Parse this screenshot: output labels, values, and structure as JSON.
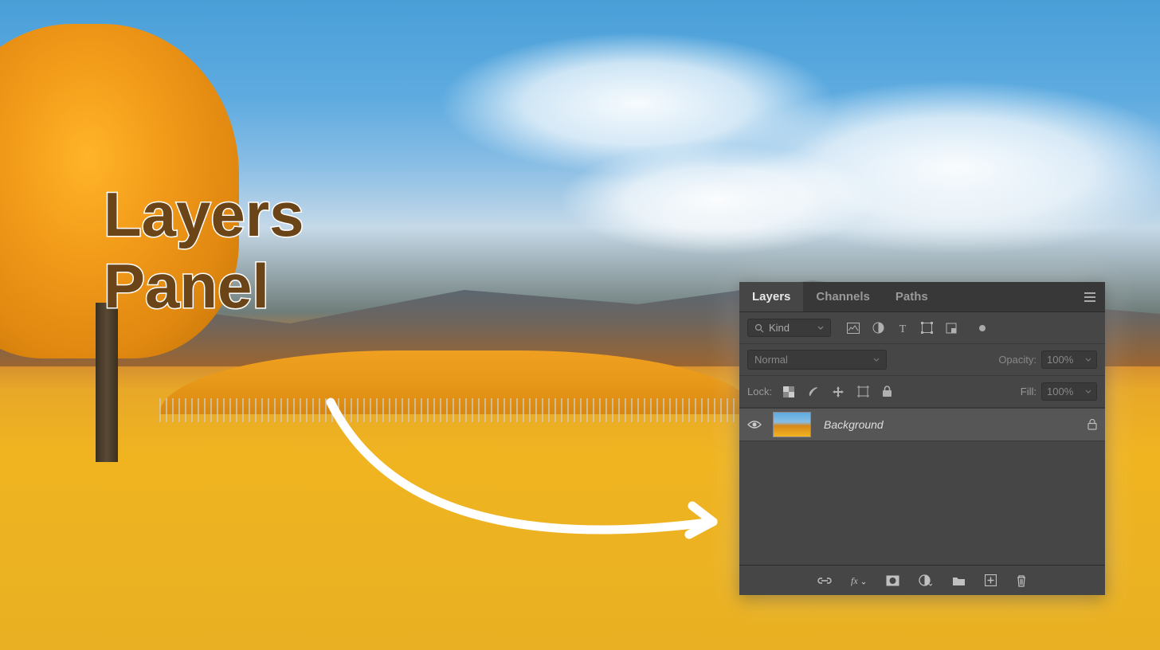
{
  "annotation": {
    "line1": "Layers",
    "line2": "Panel"
  },
  "panel": {
    "tabs": {
      "layers": "Layers",
      "channels": "Channels",
      "paths": "Paths"
    },
    "filter": {
      "kind_label": "Kind"
    },
    "blend": {
      "mode": "Normal",
      "opacity_label": "Opacity:",
      "opacity_value": "100%"
    },
    "lock": {
      "label": "Lock:",
      "fill_label": "Fill:",
      "fill_value": "100%"
    },
    "layers": [
      {
        "name": "Background",
        "locked": true,
        "visible": true
      }
    ]
  }
}
